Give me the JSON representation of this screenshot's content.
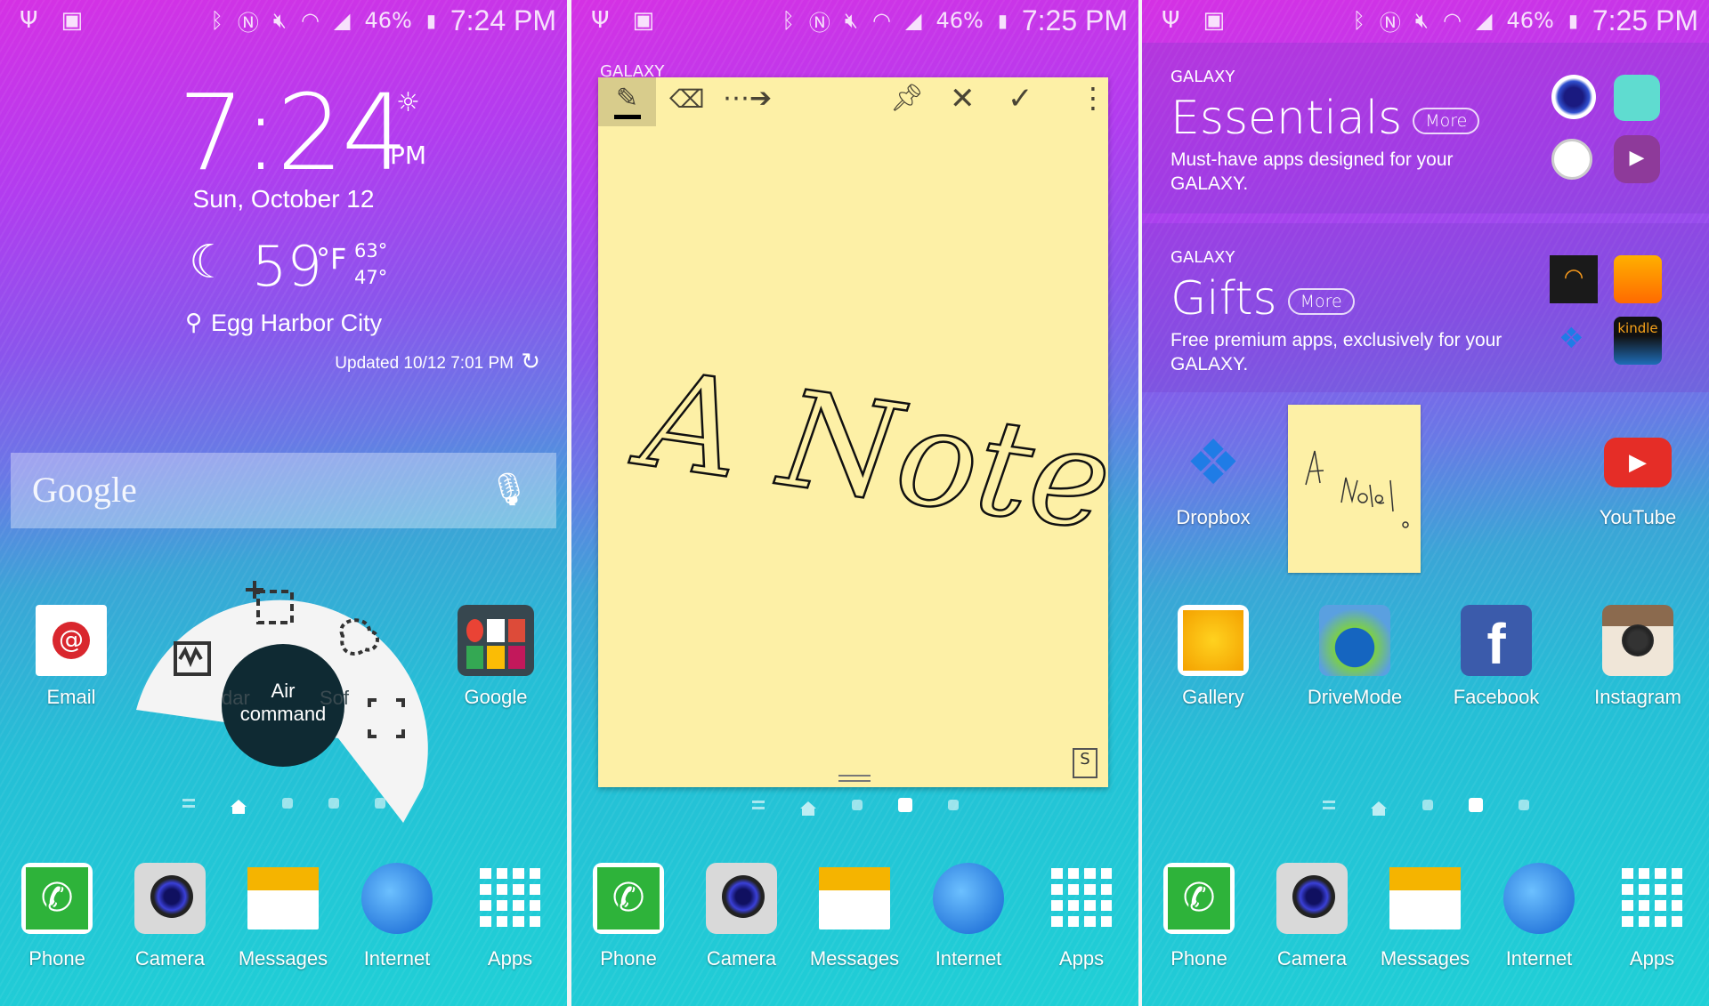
{
  "colors": {
    "note_bg": "#fdf0a6",
    "air_command_center": "#0f2a33",
    "phone_green": "#2eb33a",
    "youtube_red": "#e52d27",
    "email_red": "#d9272e",
    "facebook_blue": "#3b5bab"
  },
  "status_bars": [
    {
      "battery": "46%",
      "time": "7:24 PM",
      "icons": [
        "usb-icon",
        "gallery-icon",
        "bluetooth-icon",
        "nfc-icon",
        "mute-icon",
        "wifi-icon",
        "signal-icon",
        "battery-charging-icon"
      ]
    },
    {
      "battery": "46%",
      "time": "7:25 PM"
    },
    {
      "battery": "46%",
      "time": "7:25 PM"
    }
  ],
  "clock_widget": {
    "time": "7:24",
    "ampm": "PM",
    "date": "Sun, October 12",
    "temp": "59",
    "unit": "°F",
    "high": "63°",
    "low": "47°",
    "location": "Egg Harbor City",
    "updated": "Updated 10/12 7:01 PM"
  },
  "google_search": {
    "logo": "Google"
  },
  "home1": {
    "apps": [
      {
        "label": "Email"
      },
      {
        "label": "Google"
      }
    ]
  },
  "air_command": {
    "label_line1": "Air",
    "label_line2": "command",
    "behind_left": "dar",
    "behind_right": "Sof",
    "items": [
      "action-memo",
      "smart-select",
      "image-clip",
      "screen-write",
      "scrapbook"
    ]
  },
  "dock": [
    {
      "label": "Phone"
    },
    {
      "label": "Camera"
    },
    {
      "label": "Messages"
    },
    {
      "label": "Internet"
    },
    {
      "label": "Apps"
    }
  ],
  "note": {
    "behind_text": "GALAXY",
    "tools": [
      "pen",
      "eraser",
      "convert",
      "pin",
      "close",
      "save",
      "more"
    ],
    "handwriting": "A Note!"
  },
  "galaxy": {
    "essentials": {
      "kicker": "GALAXY",
      "title": "Essentials",
      "more": "More",
      "desc": "Must-have apps designed for your GALAXY."
    },
    "gifts": {
      "kicker": "GALAXY",
      "title": "Gifts",
      "more": "More",
      "desc": "Free premium apps, exclusively for your GALAXY."
    }
  },
  "home3": {
    "apps": [
      {
        "label": "Dropbox"
      },
      {
        "label": "YouTube"
      },
      {
        "label": "Gallery"
      },
      {
        "label": "DriveMode"
      },
      {
        "label": "Facebook"
      },
      {
        "label": "Instagram"
      }
    ]
  }
}
